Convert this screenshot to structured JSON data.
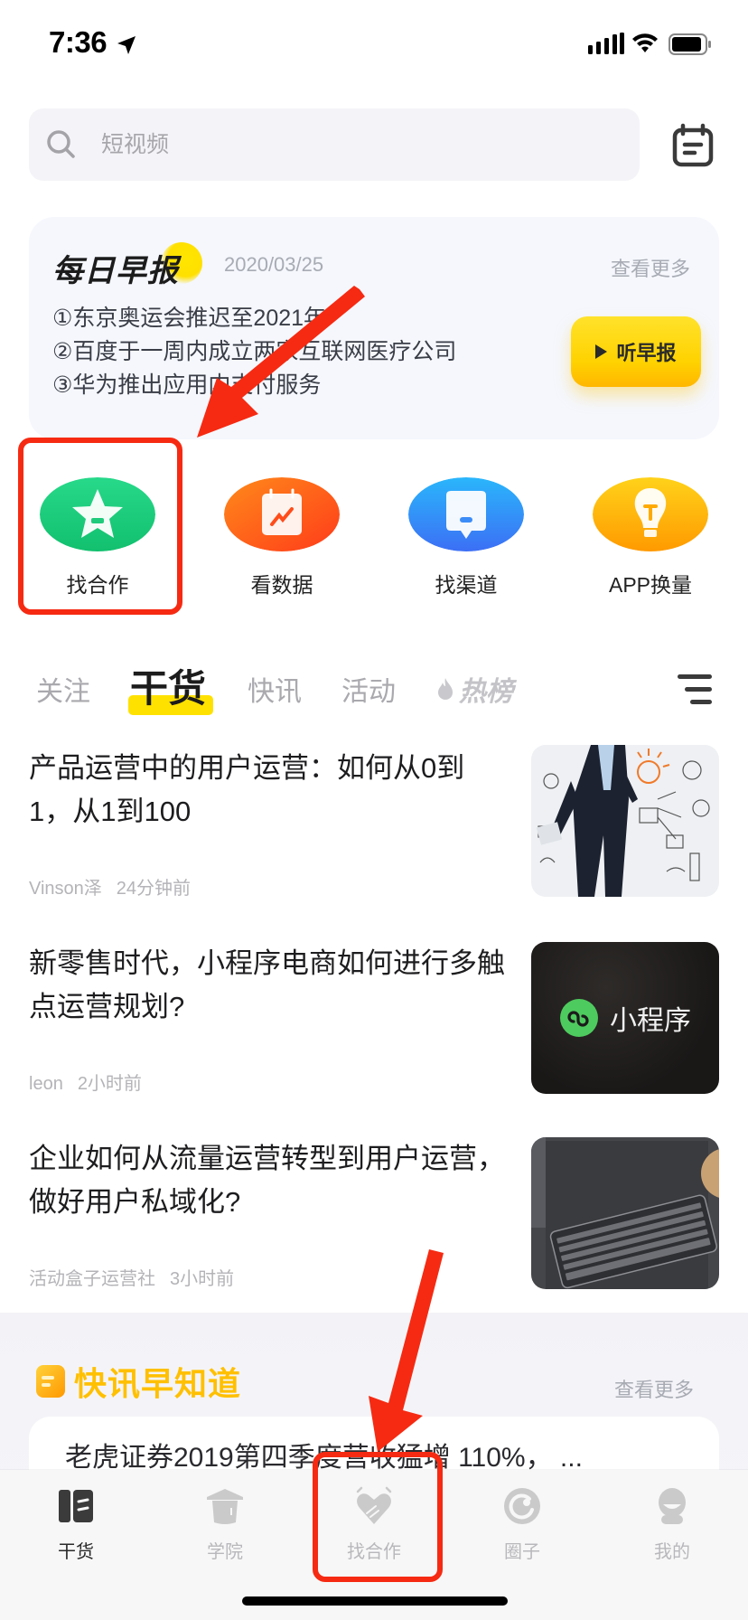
{
  "status_bar": {
    "time": "7:36"
  },
  "search": {
    "placeholder": "短视频"
  },
  "daily_report": {
    "title": "每日早报",
    "date": "2020/03/25",
    "more_label": "查看更多",
    "items": [
      "①东京奥运会推迟至2021年",
      "②百度于一周内成立两家互联网医疗公司",
      "③华为推出应用内支付服务"
    ],
    "listen_label": "听早报"
  },
  "shortcuts": [
    {
      "label": "找合作",
      "icon": "star-icon",
      "color": "#1ecb7c"
    },
    {
      "label": "看数据",
      "icon": "chart-calendar-icon",
      "color": "#ff4d1a"
    },
    {
      "label": "找渠道",
      "icon": "message-icon",
      "color": "#2f8dfa"
    },
    {
      "label": "APP换量",
      "icon": "lightbulb-icon",
      "color": "#ffb000"
    }
  ],
  "tabs": [
    {
      "label": "关注",
      "active": false
    },
    {
      "label": "干货",
      "active": true
    },
    {
      "label": "快讯",
      "active": false
    },
    {
      "label": "活动",
      "active": false
    },
    {
      "label": "热榜",
      "active": false,
      "icon": "flame-icon"
    }
  ],
  "articles": [
    {
      "title": "产品运营中的用户运营：如何从0到1，从1到100",
      "author": "Vinson泽",
      "time": "24分钟前",
      "thumb": "businessman-sketch"
    },
    {
      "title": "新零售时代，小程序电商如何进行多触点运营规划?",
      "author": "leon",
      "time": "2小时前",
      "thumb": "mini-program",
      "thumb_text": "小程序"
    },
    {
      "title": "企业如何从流量运营转型到用户运营，做好用户私域化?",
      "author": "活动盒子运营社",
      "time": "3小时前",
      "thumb": "keyboard"
    }
  ],
  "news": {
    "title": "快讯早知道",
    "more_label": "查看更多",
    "headline": "老虎证券2019第四季度营收猛增 110%， ..."
  },
  "bottom_nav": [
    {
      "label": "干货",
      "icon": "book-icon",
      "active": true
    },
    {
      "label": "学院",
      "icon": "graduation-cap-icon",
      "active": false
    },
    {
      "label": "找合作",
      "icon": "handshake-heart-icon",
      "active": false
    },
    {
      "label": "圈子",
      "icon": "circle-icon",
      "active": false
    },
    {
      "label": "我的",
      "icon": "profile-icon",
      "active": false
    }
  ],
  "colors": {
    "accent_yellow": "#ffd200",
    "annotation_red": "#f62a12",
    "news_title": "#ffc000"
  }
}
